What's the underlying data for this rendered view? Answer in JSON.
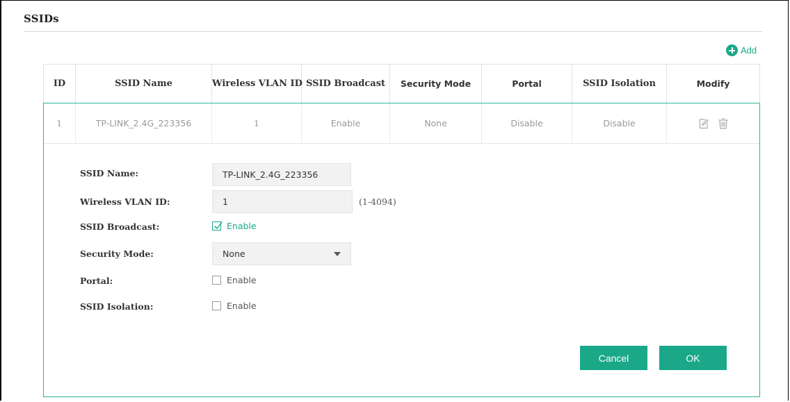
{
  "section": {
    "title": "SSIDs"
  },
  "toolbar": {
    "add_label": "Add"
  },
  "table": {
    "headers": [
      "ID",
      "SSID Name",
      "Wireless VLAN ID",
      "SSID Broadcast",
      "Security Mode",
      "Portal",
      "SSID Isolation",
      "Modify"
    ],
    "rows": [
      {
        "id": "1",
        "ssid_name": "TP-LINK_2.4G_223356",
        "vlan_id": "1",
        "broadcast": "Enable",
        "security": "None",
        "portal": "Disable",
        "isolation": "Disable"
      }
    ]
  },
  "icons": {
    "add": "plus-circle-icon",
    "edit": "edit-icon",
    "delete": "trash-icon",
    "dropdown": "caret-down-icon",
    "check": "checkmark-icon"
  },
  "form": {
    "ssid_name": {
      "label": "SSID Name:",
      "value": "TP-LINK_2.4G_223356"
    },
    "vlan_id": {
      "label": "Wireless VLAN ID:",
      "value": "1",
      "hint": "(1-4094)"
    },
    "broadcast": {
      "label": "SSID Broadcast:",
      "option": "Enable",
      "checked": true
    },
    "security_mode": {
      "label": "Security Mode:",
      "selected": "None"
    },
    "portal": {
      "label": "Portal:",
      "option": "Enable",
      "checked": false
    },
    "isolation": {
      "label": "SSID Isolation:",
      "option": "Enable",
      "checked": false
    }
  },
  "actions": {
    "cancel_label": "Cancel",
    "ok_label": "OK"
  },
  "colors": {
    "accent": "#1aa889",
    "border_active": "#2db396",
    "input_bg": "#f2f2f2",
    "muted_text": "#999999"
  }
}
